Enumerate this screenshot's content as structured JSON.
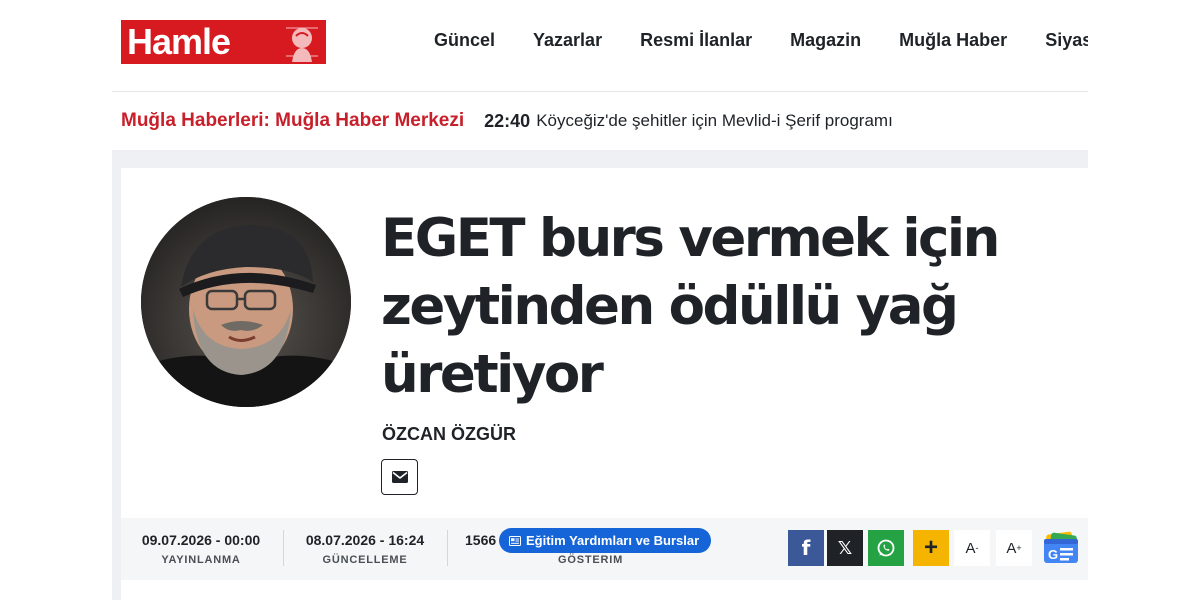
{
  "brand": {
    "logo_text": "Hamle",
    "color": "#d71920"
  },
  "nav": {
    "items": [
      "Güncel",
      "Yazarlar",
      "Resmi İlanlar",
      "Magazin",
      "Muğla Haber",
      "Siyaset"
    ]
  },
  "ticker": {
    "title": "Muğla Haberleri: Muğla Haber Merkezi",
    "time": "22:40",
    "text": "Köyceğiz'de şehitler için Mevlid-i Şerif programı"
  },
  "article": {
    "title": "EGET burs vermek için zeytinden ödüllü yağ üretiyor",
    "author": "ÖZCAN ÖZGÜR"
  },
  "meta": {
    "published": {
      "value": "09.07.2026 - 00:00",
      "label": "YAYINLANMA"
    },
    "updated": {
      "value": "08.07.2026 - 16:24",
      "label": "GÜNCELLEME"
    },
    "views": {
      "value": "1566",
      "label": "GÖSTERIM"
    },
    "category": "Eğitim Yardımları ve Burslar"
  },
  "share": {
    "facebook": "f",
    "x": "𝕏",
    "plus": "+",
    "font_decrease": "A",
    "font_increase": "A"
  },
  "icons": [
    "mail-icon",
    "facebook-icon",
    "x-icon",
    "whatsapp-icon",
    "plus-icon",
    "google-news-icon",
    "newspaper-icon"
  ],
  "colors": {
    "accent": "#c8202a",
    "category": "#1565d8",
    "facebook": "#3b5998",
    "whatsapp": "#25a244",
    "plus": "#f5b400"
  }
}
